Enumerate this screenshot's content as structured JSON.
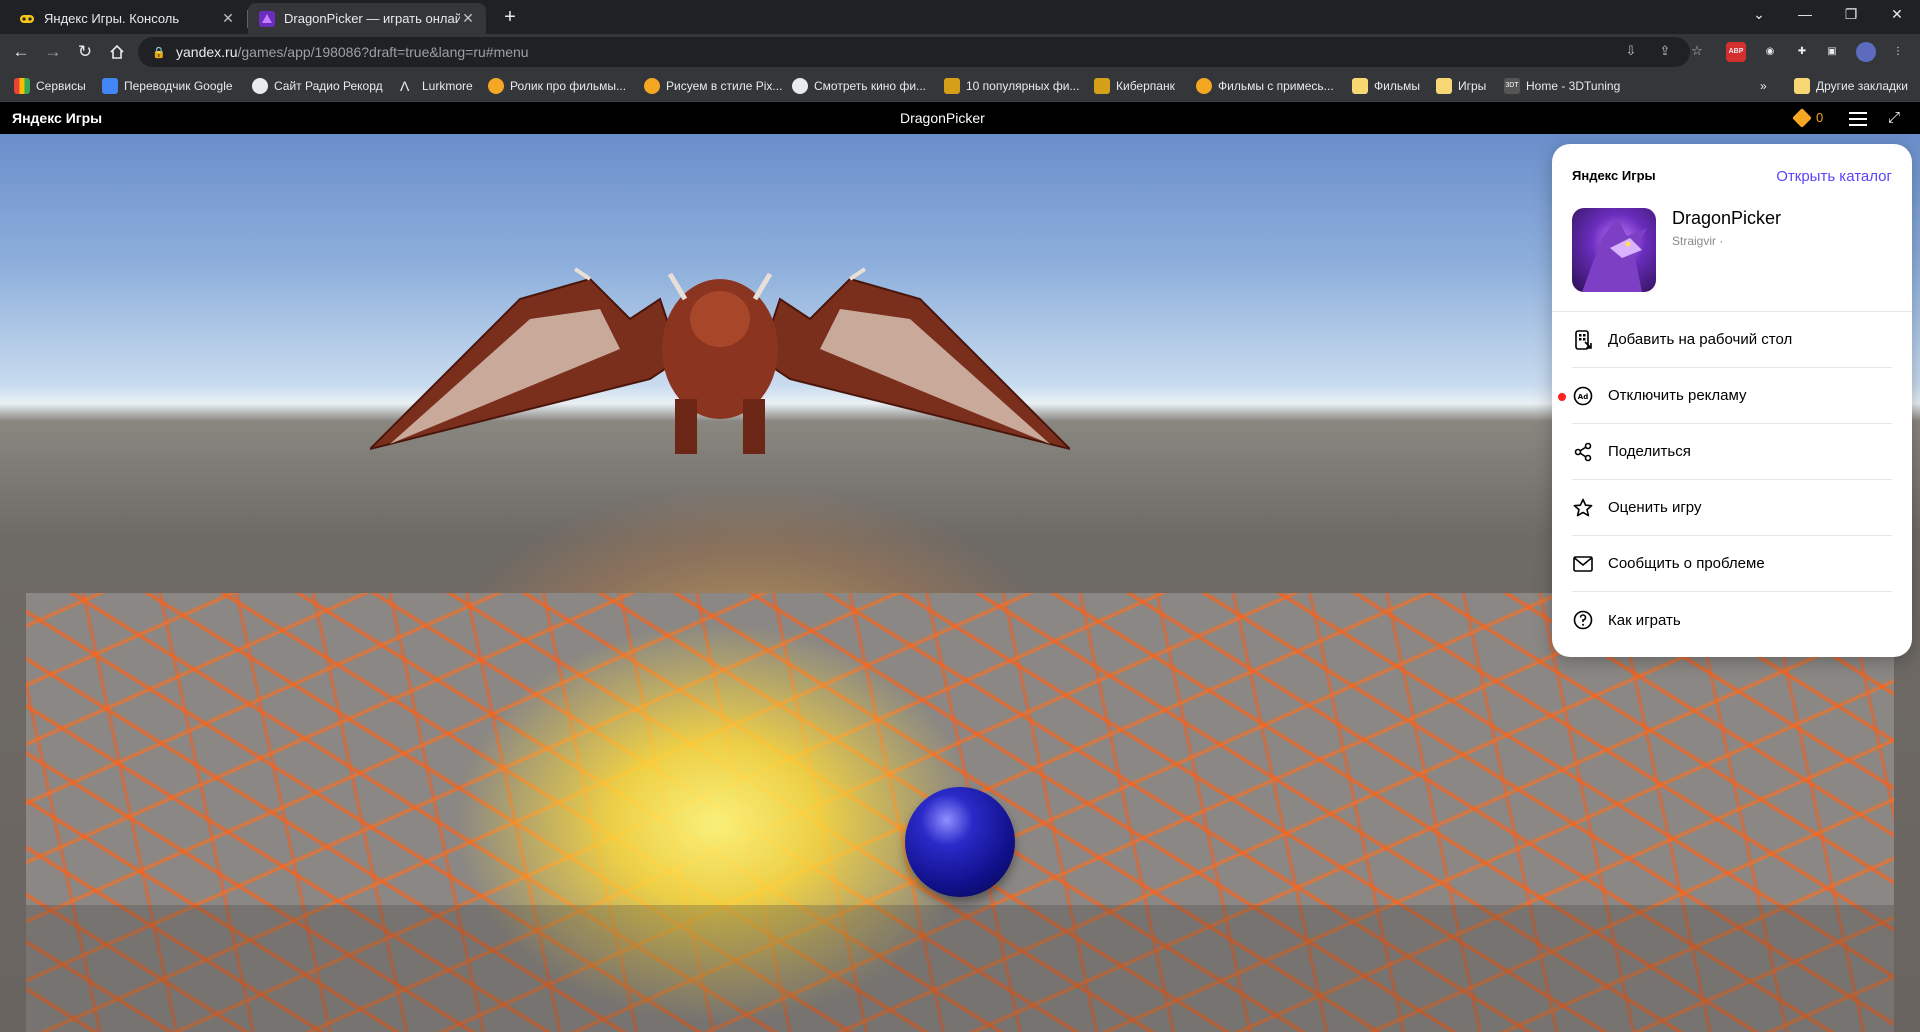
{
  "browser": {
    "tabs": [
      {
        "title": "Яндекс Игры. Консоль",
        "active": false
      },
      {
        "title": "DragonPicker — играть онлайн",
        "active": true
      }
    ],
    "address": {
      "host": "yandex.ru",
      "path": "/games/app/198086?draft=true&lang=ru#menu"
    },
    "bookmarks": [
      {
        "label": "Сервисы",
        "color": "#4285f4"
      },
      {
        "label": "Переводчик Google",
        "color": "#4285f4"
      },
      {
        "label": "Сайт Радио Рекорд",
        "color": "#e8eaed"
      },
      {
        "label": "Lurkmore",
        "color": "#e8eaed"
      },
      {
        "label": "Ролик про фильмы...",
        "color": "#f5a623"
      },
      {
        "label": "Рисуем в стиле Pix...",
        "color": "#f5a623"
      },
      {
        "label": "Смотреть кино фи...",
        "color": "#e8eaed"
      },
      {
        "label": "10 популярных фи...",
        "color": "#d4a017"
      },
      {
        "label": "Киберпанк",
        "color": "#d4a017"
      },
      {
        "label": "Фильмы с примесь...",
        "color": "#f5a623"
      },
      {
        "label": "Фильмы",
        "color": "#f7d774"
      },
      {
        "label": "Игры",
        "color": "#f7d774"
      },
      {
        "label": "Home - 3DTuning",
        "color": "#e8eaed"
      }
    ],
    "other_bookmarks": "Другие закладки",
    "extension_badge": "ABP"
  },
  "yg_header": {
    "brand": "Яндекс Игры",
    "title": "DragonPicker",
    "coins": "0"
  },
  "menu_panel": {
    "brand": "Яндекс Игры",
    "catalog_link": "Открыть каталог",
    "game_name": "DragonPicker",
    "developer": "Straigvir ·",
    "items": [
      {
        "label": "Добавить на рабочий стол",
        "icon": "desktop-add-icon"
      },
      {
        "label": "Отключить рекламу",
        "icon": "ad-off-icon",
        "notify": true
      },
      {
        "label": "Поделиться",
        "icon": "share-icon"
      },
      {
        "label": "Оценить игру",
        "icon": "star-icon"
      },
      {
        "label": "Сообщить о проблеме",
        "icon": "mail-icon"
      },
      {
        "label": "Как играть",
        "icon": "help-icon"
      }
    ]
  },
  "colors": {
    "accent": "#5a45ff",
    "coin": "#f5a623",
    "notify": "#ff2020"
  }
}
